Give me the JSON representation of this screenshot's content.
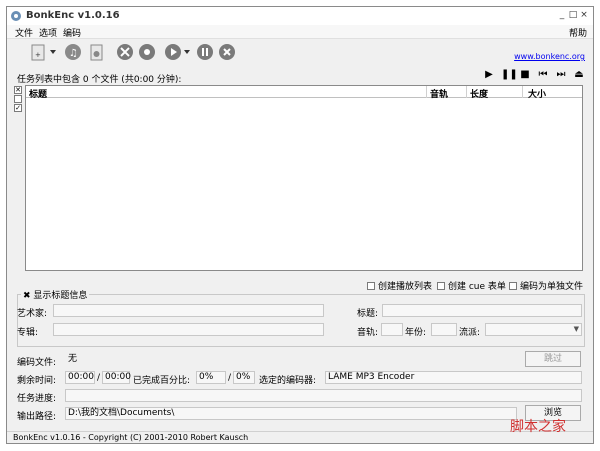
{
  "window": {
    "title": "BonkEnc v1.0.16",
    "controls": [
      "_",
      "□",
      "×"
    ]
  },
  "menu": {
    "items": [
      "文件",
      "选项",
      "编码"
    ],
    "help": "帮助"
  },
  "toolbar": {
    "icons": [
      "add-file-icon",
      "dropdown-icon",
      "cddb-icon",
      "disc-icon",
      "config-icon",
      "gear-icon",
      "play-icon",
      "dropdown-icon",
      "pause-icon",
      "close-icon"
    ],
    "site_link": "www.bonkenc.org"
  },
  "joblist": {
    "summary": "任务列表中包含 0 个文件 (共0:00 分钟):",
    "transport": [
      "▶",
      "❚❚",
      "■",
      "⏮",
      "⏭",
      "⏏"
    ],
    "side_marks": [
      "✕",
      "",
      "✓"
    ],
    "columns": [
      "标题",
      "音轨",
      "长度",
      "大小"
    ]
  },
  "options": {
    "create_playlist": "创建播放列表",
    "create_cue": "创建 cue 表单",
    "encode_single": "编码为单独文件"
  },
  "tag_info": {
    "toggle": "✖ 显示标题信息",
    "artist": "艺术家:",
    "title": "标题:",
    "album": "专辑:",
    "track": "音轨:",
    "year": "年份:",
    "genre": "流派:"
  },
  "progress": {
    "encoding_file_label": "编码文件:",
    "encoding_file_value": "无",
    "skip": "跳过",
    "time_left_label": "剩余时间:",
    "time_left": "00:00",
    "time_sep": "/",
    "time_total": "00:00",
    "percent_label": "已完成百分比:",
    "percent_done": "0%",
    "percent_sep": "/",
    "percent_total": "0%",
    "encoder_label": "选定的编码器:",
    "encoder_value": "LAME MP3 Encoder",
    "progress_label": "任务进度:",
    "output_label": "输出路径:",
    "output_value": "D:\\我的文档\\Documents\\",
    "browse": "浏览"
  },
  "statusbar": {
    "text": "BonkEnc v1.0.16 - Copyright (C) 2001-2010 Robert Kausch"
  },
  "watermark": "脚本之家"
}
